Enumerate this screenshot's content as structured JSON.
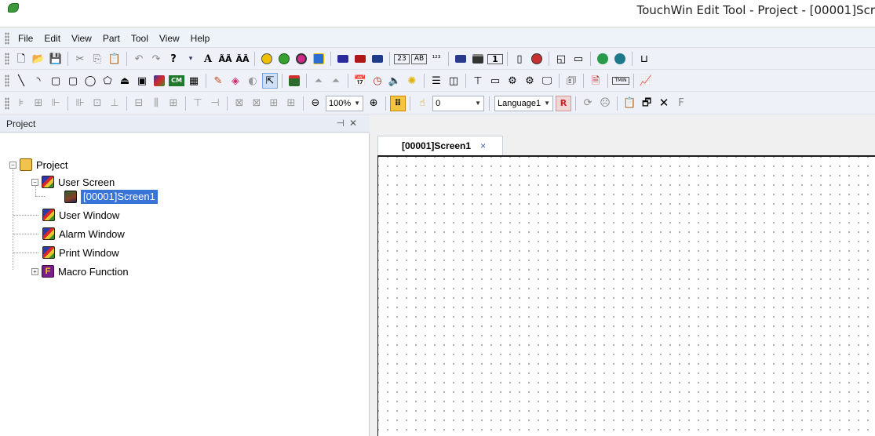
{
  "window": {
    "title": "TouchWin Edit Tool - Project - [00001]Scr"
  },
  "menu": [
    "File",
    "Edit",
    "View",
    "Part",
    "Tool",
    "View",
    "Help"
  ],
  "toolbar3": {
    "zoom_value": "100%",
    "offset_value": "0",
    "language_value": "Language1",
    "trailing_letter": "F"
  },
  "project_panel": {
    "title": "Project",
    "pin_icon": "pin-icon",
    "close_icon": "close-icon",
    "tree": {
      "root": "Project",
      "items": [
        {
          "label": "User Screen",
          "icon": "screen-icon"
        },
        {
          "label": "[00001]Screen1",
          "icon": "screen-thumbnail-icon",
          "selected": true
        },
        {
          "label": "User Window",
          "icon": "screen-icon"
        },
        {
          "label": "Alarm Window",
          "icon": "screen-icon"
        },
        {
          "label": "Print Window",
          "icon": "screen-icon"
        },
        {
          "label": "Macro Function",
          "icon": "macro-icon",
          "icon_text": "F"
        }
      ]
    }
  },
  "document": {
    "tab_label": "[00001]Screen1",
    "tab_close": "×"
  },
  "colors": {
    "selection": "#3874d8",
    "grid_dot": "#6e6e6e",
    "menubar": "#eef2f9"
  }
}
